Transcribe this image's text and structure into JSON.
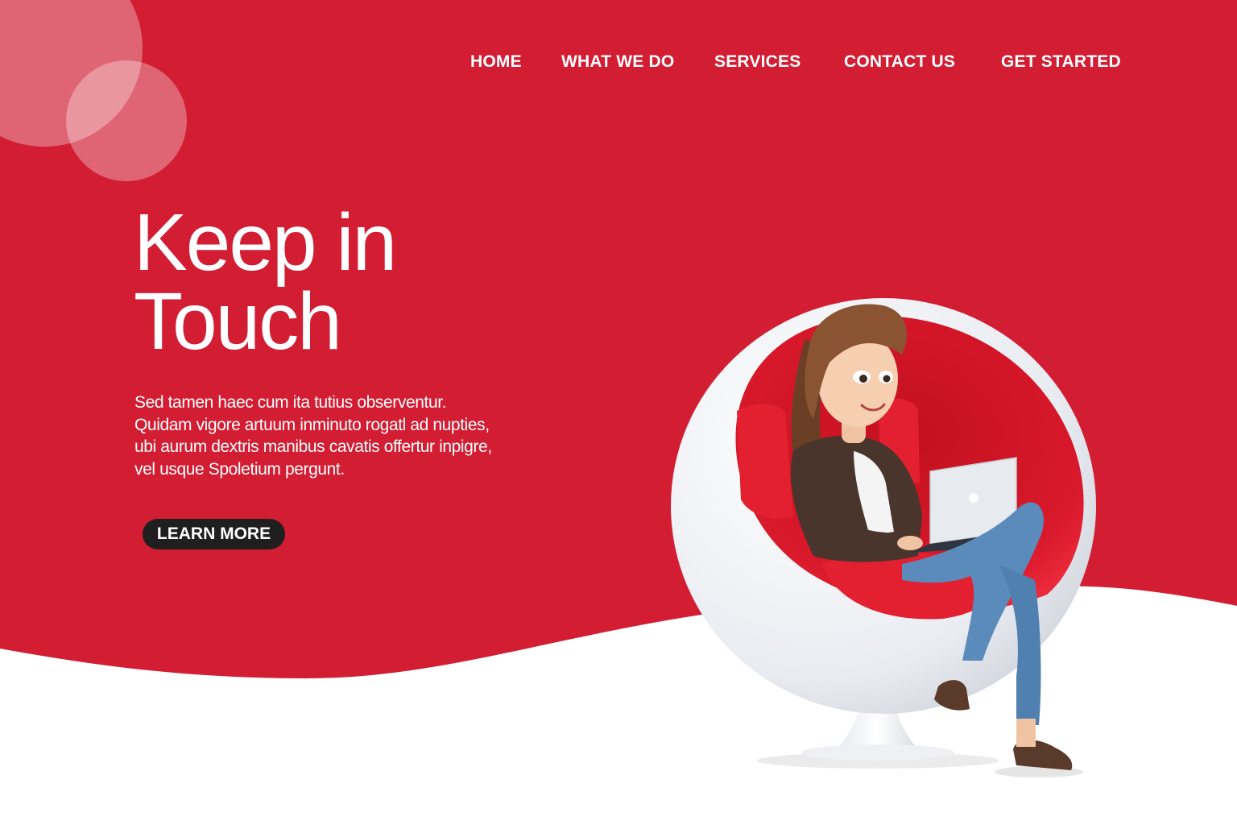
{
  "colors": {
    "brand_red": "#d21d33",
    "bubble": "#f1a6b0",
    "button_bg": "#1f1f1f",
    "text_light": "#ffffff"
  },
  "nav": {
    "items": [
      {
        "label": "HOME"
      },
      {
        "label": "WHAT WE DO"
      },
      {
        "label": "SERVICES"
      },
      {
        "label": "CONTACT US"
      },
      {
        "label": "GET STARTED"
      }
    ]
  },
  "hero": {
    "title_lines": [
      "Keep in",
      "Touch"
    ],
    "body_lines": [
      "Sed tamen haec cum ita tutius observentur.",
      "Quidam vigore artuum inminuto rogatl ad nupties,",
      "ubi aurum dextris manibus cavatis offertur inpigre,",
      "vel usque Spoletium pergunt."
    ],
    "cta_label": "LEARN MORE"
  },
  "illustration": {
    "subject": "woman-in-egg-chair-with-laptop",
    "icon": "person-laptop-icon"
  }
}
